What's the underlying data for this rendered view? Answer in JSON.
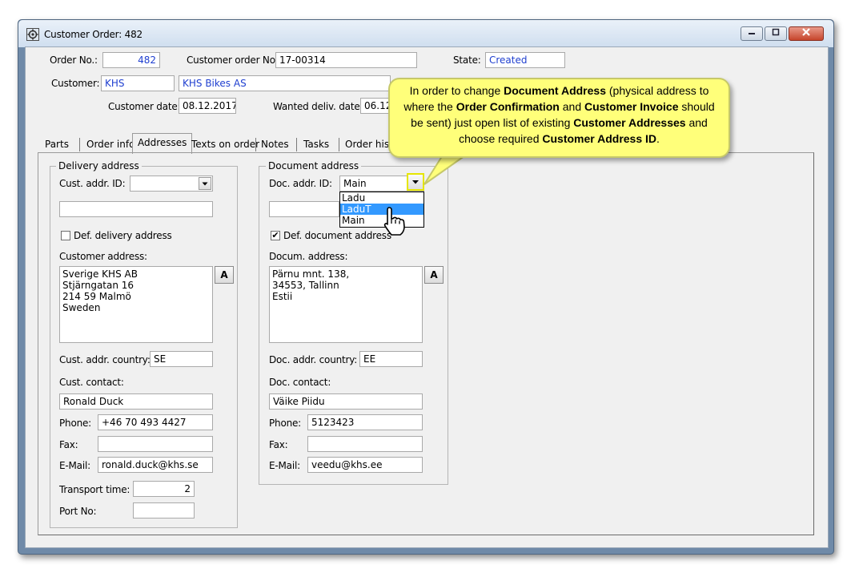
{
  "window": {
    "title": "Customer Order: 482"
  },
  "header": {
    "order_no_label": "Order No.:",
    "order_no": "482",
    "customer_order_no_label": "Customer order No.:",
    "customer_order_no": "17-00314",
    "state_label": "State:",
    "state": "Created",
    "customer_label": "Customer:",
    "customer_code": "KHS",
    "customer_name": "KHS Bikes AS",
    "customer_date_label": "Customer date:",
    "customer_date": "08.12.2017",
    "wanted_deliv_label": "Wanted deliv. date:",
    "wanted_deliv_date": "06.12"
  },
  "tabs": [
    "Parts",
    "Order info",
    "Addresses",
    "Texts on order",
    "Notes",
    "Tasks",
    "Order hist"
  ],
  "active_tab": "Addresses",
  "delivery": {
    "group_title": "Delivery address",
    "addr_id_label": "Cust. addr. ID:",
    "addr_id_value": "",
    "name_value": "",
    "default_label": "Def. delivery address",
    "default_checked": false,
    "address_label": "Customer address:",
    "address_text": "Sverige KHS AB\nStjärngatan 16\n214 59 Malmö\nSweden",
    "address_button": "A",
    "country_label": "Cust. addr. country:",
    "country": "SE",
    "contact_label": "Cust. contact:",
    "contact": "Ronald Duck",
    "phone_label": "Phone:",
    "phone": "+46 70 493 4427",
    "fax_label": "Fax:",
    "fax": "",
    "email_label": "E-Mail:",
    "email": "ronald.duck@khs.se",
    "transport_label": "Transport time:",
    "transport_time": "2",
    "port_label": "Port No:",
    "port_no": ""
  },
  "document": {
    "group_title": "Document address",
    "addr_id_label": "Doc. addr. ID:",
    "addr_id_value": "Main",
    "dropdown_options": [
      "Ladu",
      "LaduT",
      "Main"
    ],
    "dropdown_highlighted": "LaduT",
    "default_label": "Def. document address",
    "default_checked": true,
    "check_mark": "✔",
    "address_label": "Docum. address:",
    "address_text": "Pärnu mnt. 138,\n34553, Tallinn\nEstii",
    "address_button": "A",
    "country_label": "Doc. addr. country:",
    "country": "EE",
    "contact_label": "Doc. contact:",
    "contact": "Väike Piidu",
    "phone_label": "Phone:",
    "phone": "5123423",
    "fax_label": "Fax:",
    "fax": "",
    "email_label": "E-Mail:",
    "email": "veedu@khs.ee"
  },
  "callout": {
    "parts": [
      {
        "t": "In order to change ",
        "b": false
      },
      {
        "t": "Document Address",
        "b": true
      },
      {
        "t": " (physical address to where the ",
        "b": false
      },
      {
        "t": "Order Confirmation",
        "b": true
      },
      {
        "t": " and ",
        "b": false
      },
      {
        "t": "Customer Invoice",
        "b": true
      },
      {
        "t": " should be sent) just open list of existing ",
        "b": false
      },
      {
        "t": "Customer Addresses",
        "b": true
      },
      {
        "t": " and choose required ",
        "b": false
      },
      {
        "t": "Customer Address ID",
        "b": true
      },
      {
        "t": ".",
        "b": false
      }
    ]
  },
  "colors": {
    "value_text": "#1f3fd0",
    "highlight": "#3399ff",
    "callout_bg": "#ffff7a",
    "yellow_marker": "#e6e600"
  }
}
